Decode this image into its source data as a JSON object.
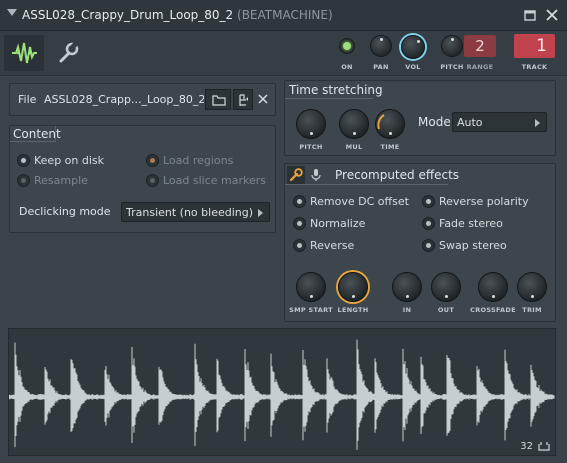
{
  "window": {
    "title": "ASSL028_Crappy_Drum_Loop_80_2",
    "subtitle": "(BEATMACHINE)"
  },
  "toolbar": {
    "on_label": "ON",
    "pan_label": "PAN",
    "vol_label": "VOL",
    "pitch_label": "PITCH",
    "range_label": "RANGE",
    "range_value": "2",
    "track_label": "TRACK",
    "track_value": "1"
  },
  "file": {
    "label": "File",
    "name": "ASSL028_Crapp..._Loop_80_2.wav"
  },
  "content": {
    "heading": "Content",
    "options": [
      {
        "label": "Keep on disk"
      },
      {
        "label": "Load regions"
      },
      {
        "label": "Resample"
      },
      {
        "label": "Load slice markers"
      }
    ],
    "declicking_label": "Declicking mode",
    "declicking_value": "Transient (no bleeding)"
  },
  "time_stretching": {
    "heading": "Time stretching",
    "knobs": [
      "PITCH",
      "MUL",
      "TIME"
    ],
    "mode_label": "Mode",
    "mode_value": "Auto"
  },
  "precomputed": {
    "heading": "Precomputed effects",
    "options": [
      {
        "label": "Remove DC offset"
      },
      {
        "label": "Reverse polarity"
      },
      {
        "label": "Normalize"
      },
      {
        "label": "Fade stereo"
      },
      {
        "label": "Reverse"
      },
      {
        "label": "Swap stereo"
      }
    ],
    "knobs": [
      "SMP START",
      "LENGTH",
      "IN",
      "OUT",
      "CROSSFADE",
      "TRIM"
    ]
  },
  "waveform": {
    "zoom_value": "32"
  },
  "colors": {
    "accent_green": "#9be07a",
    "vol_ring": "#7fd1ee",
    "orange": "#e9a43a",
    "range_red": "#8c3b42",
    "track_red": "#c0424d"
  }
}
